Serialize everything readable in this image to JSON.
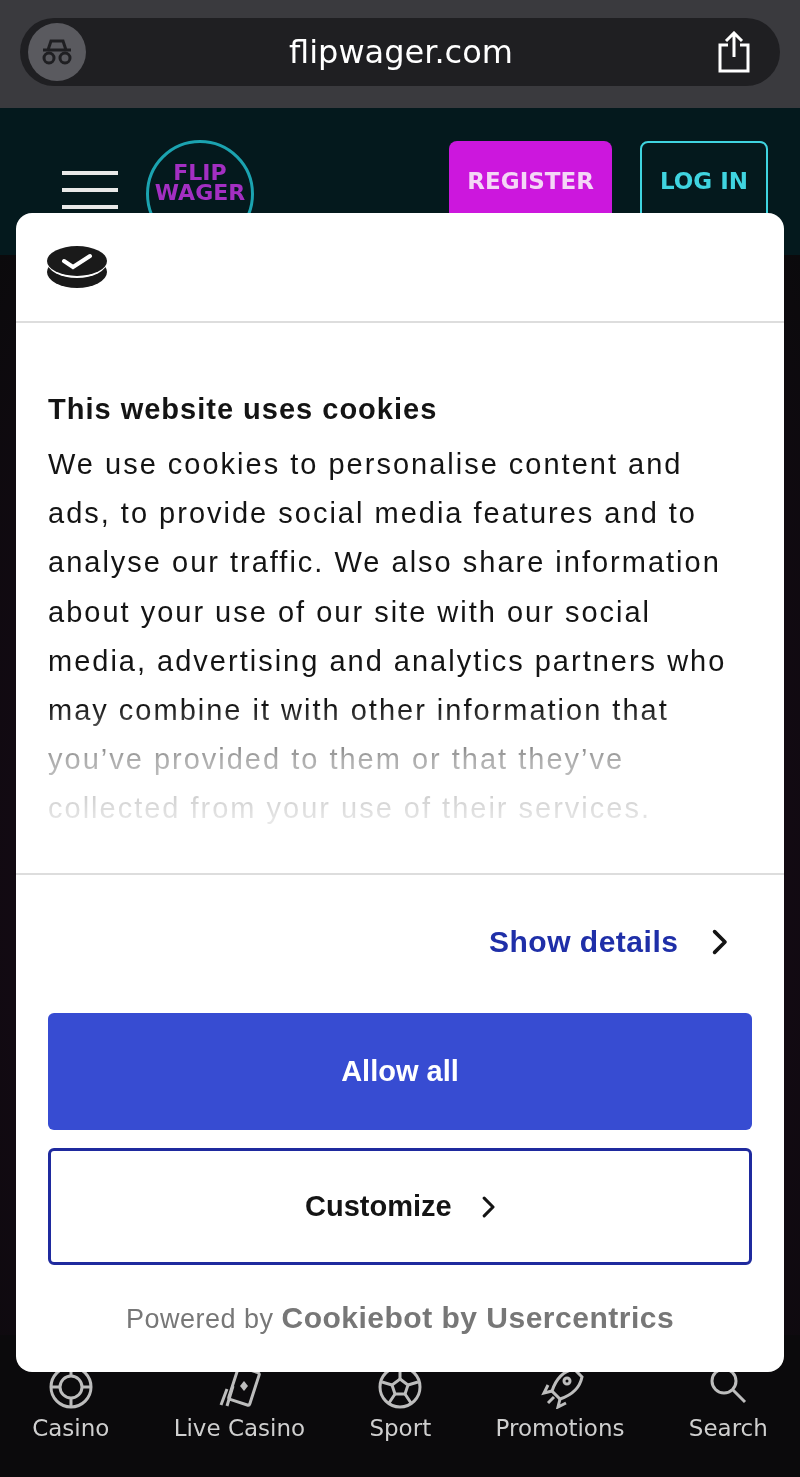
{
  "browser": {
    "url": "flipwager.com"
  },
  "header": {
    "logo_lines": [
      "FLIP",
      "WAGER"
    ],
    "buttons": [
      {
        "label": "REGISTER",
        "kind": "primary"
      },
      {
        "label": "LOG IN",
        "kind": "outline"
      }
    ]
  },
  "cookie_dialog": {
    "title": "This website uses cookies",
    "body": "We use cookies to personalise content and ads, to provide social media features and to analyse our traffic. We also share information about your use of our site with our social media, advertising and analytics partners who may combine it with other information that you’ve provided to them or that they’ve collected from your use of their services.",
    "details_link": "Show details",
    "buttons": [
      {
        "label": "Allow all",
        "kind": "filled"
      },
      {
        "label": "Customize",
        "kind": "outline"
      }
    ],
    "footer": "Powered by **Cookiebot by Usercentrics**"
  },
  "bottom_nav": [
    {
      "label": "Casino",
      "kind": "chip"
    },
    {
      "label": "Live Casino",
      "kind": "cards"
    },
    {
      "label": "Sport",
      "kind": "ball"
    },
    {
      "label": "Promotions",
      "kind": "rocket"
    },
    {
      "label": "Search",
      "kind": "search"
    }
  ]
}
